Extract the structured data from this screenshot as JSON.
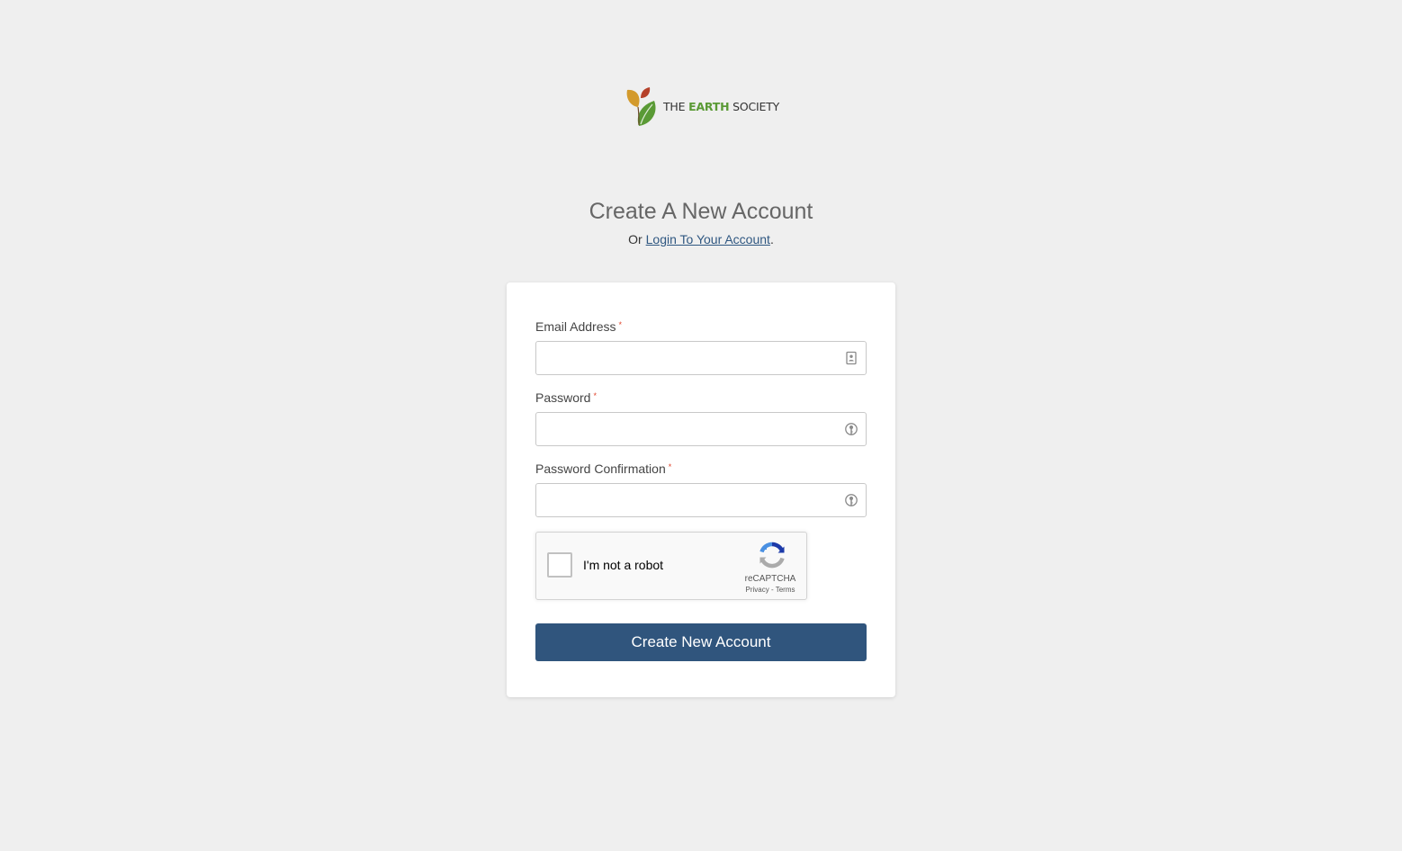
{
  "brand": {
    "logo_text_prefix": "THE ",
    "logo_text_accent": "EARTH",
    "logo_text_suffix": " SOCIETY",
    "colors": {
      "leaf_orange": "#d39a2c",
      "leaf_red": "#b5412a",
      "leaf_green": "#5a9a35",
      "accent_green": "#5a9a35"
    }
  },
  "page": {
    "title": "Create A New Account",
    "subtitle_prefix": "Or ",
    "login_link": "Login To Your Account",
    "subtitle_suffix": "."
  },
  "form": {
    "required_marker": "*",
    "email": {
      "label": "Email Address",
      "value": "",
      "placeholder": "",
      "icon": "contact-card-icon"
    },
    "password": {
      "label": "Password",
      "value": "",
      "placeholder": "",
      "icon": "key-icon"
    },
    "password_confirmation": {
      "label": "Password Confirmation",
      "value": "",
      "placeholder": "",
      "icon": "key-icon"
    },
    "captcha": {
      "label": "I'm not a robot",
      "brand": "reCAPTCHA",
      "privacy": "Privacy",
      "separator": " - ",
      "terms": "Terms",
      "checked": false
    },
    "submit_label": "Create New Account"
  },
  "theme": {
    "background": "#efefef",
    "primary_button": "#30557d",
    "link": "#2f5781",
    "required": "#e0442c"
  }
}
